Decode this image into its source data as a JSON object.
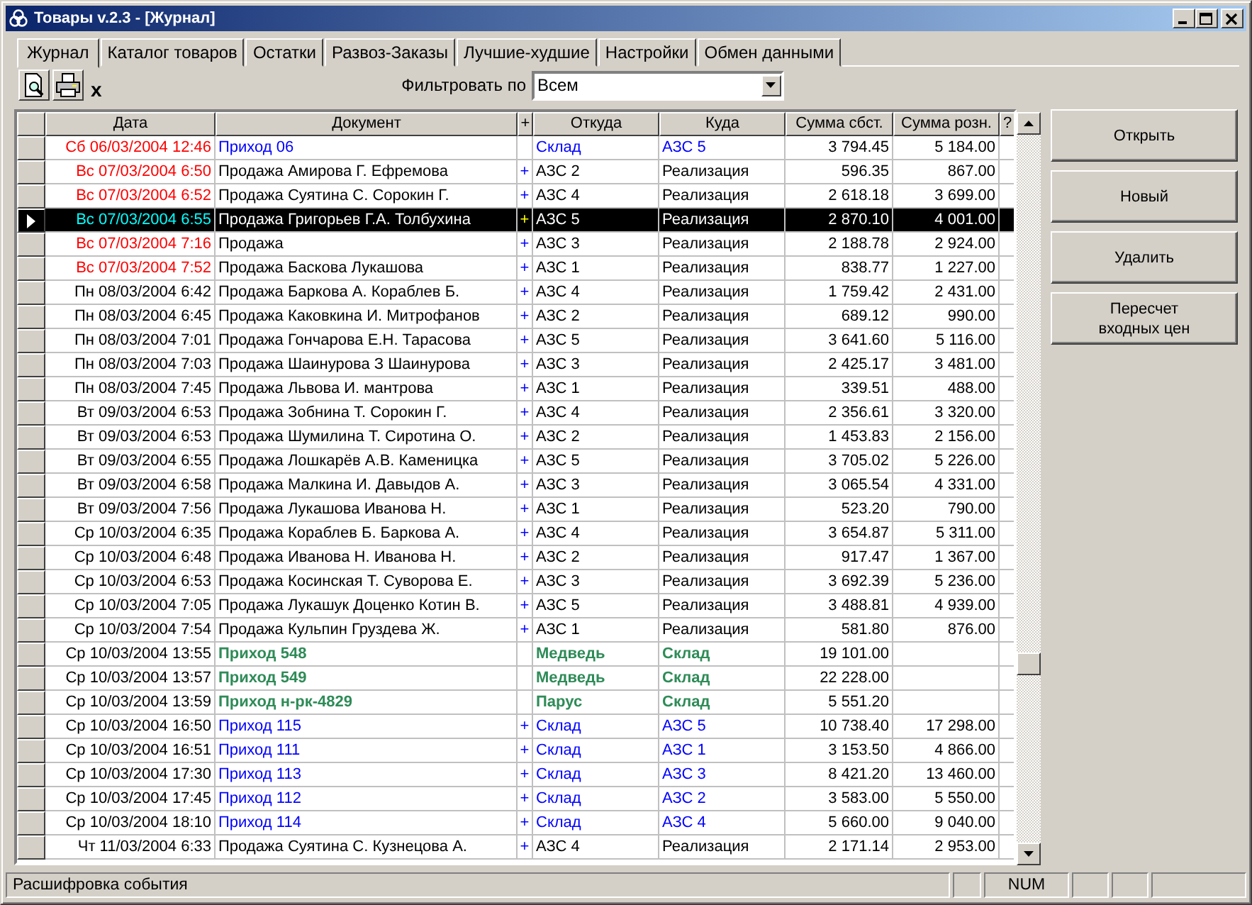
{
  "window": {
    "title": "Товары v.2.3 - [Журнал]"
  },
  "tabs": [
    {
      "label": "Журнал",
      "selected": true
    },
    {
      "label": "Каталог товаров",
      "selected": false
    },
    {
      "label": "Остатки",
      "selected": false
    },
    {
      "label": "Развоз-Заказы",
      "selected": false
    },
    {
      "label": "Лучшие-худшие",
      "selected": false
    },
    {
      "label": "Настройки",
      "selected": false
    },
    {
      "label": "Обмен данными",
      "selected": false
    }
  ],
  "toolbar": {
    "clear_label": "x"
  },
  "filter": {
    "label": "Фильтровать по",
    "value": "Всем"
  },
  "table": {
    "columns": [
      "Дата",
      "Документ",
      "+",
      "Откуда",
      "Куда",
      "Сумма сбст.",
      "Сумма розн.",
      "?"
    ],
    "rows": [
      {
        "date": "Сб 06/03/2004 12:46",
        "weekend": true,
        "document": "Приход 06",
        "from": "Склад",
        "to": "АЗС 5",
        "cost": "3 794.45",
        "retail": "5 184.00",
        "kind": "incoming",
        "selected": false
      },
      {
        "date": "Вс 07/03/2004 6:50",
        "weekend": true,
        "document": "Продажа Амирова Г. Ефремова",
        "plus": "+",
        "from": "АЗС 2",
        "to": "Реализация",
        "cost": "596.35",
        "retail": "867.00",
        "kind": "sale",
        "selected": false
      },
      {
        "date": "Вс 07/03/2004 6:52",
        "weekend": true,
        "document": "Продажа Суятина С. Сорокин Г.",
        "plus": "+",
        "from": "АЗС 4",
        "to": "Реализация",
        "cost": "2 618.18",
        "retail": "3 699.00",
        "kind": "sale",
        "selected": false
      },
      {
        "date": "Вс 07/03/2004 6:55",
        "weekend": true,
        "document": "Продажа Григорьев Г.А. Толбухина",
        "plus": "+",
        "from": "АЗС 5",
        "to": "Реализация",
        "cost": "2 870.10",
        "retail": "4 001.00",
        "kind": "sale",
        "selected": true
      },
      {
        "date": "Вс 07/03/2004 7:16",
        "weekend": true,
        "document": "Продажа",
        "plus": "+",
        "from": "АЗС 3",
        "to": "Реализация",
        "cost": "2 188.78",
        "retail": "2 924.00",
        "kind": "sale",
        "selected": false
      },
      {
        "date": "Вс 07/03/2004 7:52",
        "weekend": true,
        "document": "Продажа Баскова Лукашова",
        "plus": "+",
        "from": "АЗС 1",
        "to": "Реализация",
        "cost": "838.77",
        "retail": "1 227.00",
        "kind": "sale",
        "selected": false
      },
      {
        "date": "Пн 08/03/2004 6:42",
        "weekend": false,
        "document": "Продажа Баркова А. Кораблев Б.",
        "plus": "+",
        "from": "АЗС 4",
        "to": "Реализация",
        "cost": "1 759.42",
        "retail": "2 431.00",
        "kind": "sale",
        "selected": false
      },
      {
        "date": "Пн 08/03/2004 6:45",
        "weekend": false,
        "document": "Продажа Каковкина И. Митрофанов",
        "plus": "+",
        "from": "АЗС 2",
        "to": "Реализация",
        "cost": "689.12",
        "retail": "990.00",
        "kind": "sale",
        "selected": false
      },
      {
        "date": "Пн 08/03/2004 7:01",
        "weekend": false,
        "document": "Продажа Гончарова Е.Н. Тарасова",
        "plus": "+",
        "from": "АЗС 5",
        "to": "Реализация",
        "cost": "3 641.60",
        "retail": "5 116.00",
        "kind": "sale",
        "selected": false
      },
      {
        "date": "Пн 08/03/2004 7:03",
        "weekend": false,
        "document": "Продажа  Шаинурова З Шаинурова",
        "plus": "+",
        "from": "АЗС 3",
        "to": "Реализация",
        "cost": "2 425.17",
        "retail": "3 481.00",
        "kind": "sale",
        "selected": false
      },
      {
        "date": "Пн 08/03/2004 7:45",
        "weekend": false,
        "document": "Продажа Львова И. мантрова",
        "plus": "+",
        "from": "АЗС 1",
        "to": "Реализация",
        "cost": "339.51",
        "retail": "488.00",
        "kind": "sale",
        "selected": false
      },
      {
        "date": "Вт 09/03/2004 6:53",
        "weekend": false,
        "document": "Продажа Зобнина Т. Сорокин Г.",
        "plus": "+",
        "from": "АЗС 4",
        "to": "Реализация",
        "cost": "2 356.61",
        "retail": "3 320.00",
        "kind": "sale",
        "selected": false
      },
      {
        "date": "Вт 09/03/2004 6:53",
        "weekend": false,
        "document": "Продажа Шумилина Т. Сиротина О.",
        "plus": "+",
        "from": "АЗС 2",
        "to": "Реализация",
        "cost": "1 453.83",
        "retail": "2 156.00",
        "kind": "sale",
        "selected": false
      },
      {
        "date": "Вт 09/03/2004 6:55",
        "weekend": false,
        "document": "Продажа Лошкарёв А.В. Каменицка",
        "plus": "+",
        "from": "АЗС 5",
        "to": "Реализация",
        "cost": "3 705.02",
        "retail": "5 226.00",
        "kind": "sale",
        "selected": false
      },
      {
        "date": "Вт 09/03/2004 6:58",
        "weekend": false,
        "document": "Продажа Малкина И. Давыдов А.",
        "plus": "+",
        "from": "АЗС 3",
        "to": "Реализация",
        "cost": "3 065.54",
        "retail": "4 331.00",
        "kind": "sale",
        "selected": false
      },
      {
        "date": "Вт 09/03/2004 7:56",
        "weekend": false,
        "document": "Продажа Лукашова Иванова Н.",
        "plus": "+",
        "from": "АЗС 1",
        "to": "Реализация",
        "cost": "523.20",
        "retail": "790.00",
        "kind": "sale",
        "selected": false
      },
      {
        "date": "Ср 10/03/2004 6:35",
        "weekend": false,
        "document": "Продажа Кораблев Б. Баркова А.",
        "plus": "+",
        "from": "АЗС 4",
        "to": "Реализация",
        "cost": "3 654.87",
        "retail": "5 311.00",
        "kind": "sale",
        "selected": false
      },
      {
        "date": "Ср 10/03/2004 6:48",
        "weekend": false,
        "document": "Продажа Иванова Н. Иванова Н.",
        "plus": "+",
        "from": "АЗС 2",
        "to": "Реализация",
        "cost": "917.47",
        "retail": "1 367.00",
        "kind": "sale",
        "selected": false
      },
      {
        "date": "Ср 10/03/2004 6:53",
        "weekend": false,
        "document": "Продажа Косинская Т. Суворова Е.",
        "plus": "+",
        "from": "АЗС 3",
        "to": "Реализация",
        "cost": "3 692.39",
        "retail": "5 236.00",
        "kind": "sale",
        "selected": false
      },
      {
        "date": "Ср 10/03/2004 7:05",
        "weekend": false,
        "document": "Продажа Лукашук Доценко Котин В.",
        "plus": "+",
        "from": "АЗС 5",
        "to": "Реализация",
        "cost": "3 488.81",
        "retail": "4 939.00",
        "kind": "sale",
        "selected": false
      },
      {
        "date": "Ср 10/03/2004 7:54",
        "weekend": false,
        "document": "Продажа Кульпин Груздева Ж.",
        "plus": "+",
        "from": "АЗС 1",
        "to": "Реализация",
        "cost": "581.80",
        "retail": "876.00",
        "kind": "sale",
        "selected": false
      },
      {
        "date": "Ср 10/03/2004 13:55",
        "weekend": false,
        "document": "Приход 548",
        "from": "Медведь",
        "to": "Склад",
        "cost": "19 101.00",
        "kind": "supplier",
        "selected": false
      },
      {
        "date": "Ср 10/03/2004 13:57",
        "weekend": false,
        "document": "Приход 549",
        "from": "Медведь",
        "to": "Склад",
        "cost": "22 228.00",
        "kind": "supplier",
        "selected": false
      },
      {
        "date": "Ср 10/03/2004 13:59",
        "weekend": false,
        "document": "Приход н-рк-4829",
        "from": "Парус",
        "to": "Склад",
        "cost": "5 551.20",
        "kind": "supplier",
        "selected": false
      },
      {
        "date": "Ср 10/03/2004 16:50",
        "weekend": false,
        "document": "Приход 115",
        "plus": "+",
        "from": "Склад",
        "to": "АЗС 5",
        "cost": "10 738.40",
        "retail": "17 298.00",
        "kind": "incoming",
        "selected": false
      },
      {
        "date": "Ср 10/03/2004 16:51",
        "weekend": false,
        "document": "Приход 111",
        "plus": "+",
        "from": "Склад",
        "to": "АЗС 1",
        "cost": "3 153.50",
        "retail": "4 866.00",
        "kind": "incoming",
        "selected": false
      },
      {
        "date": "Ср 10/03/2004 17:30",
        "weekend": false,
        "document": "Приход 113",
        "plus": "+",
        "from": "Склад",
        "to": "АЗС 3",
        "cost": "8 421.20",
        "retail": "13 460.00",
        "kind": "incoming",
        "selected": false
      },
      {
        "date": "Ср 10/03/2004 17:45",
        "weekend": false,
        "document": "Приход 112",
        "plus": "+",
        "from": "Склад",
        "to": "АЗС 2",
        "cost": "3 583.00",
        "retail": "5 550.00",
        "kind": "incoming",
        "selected": false
      },
      {
        "date": "Ср 10/03/2004 18:10",
        "weekend": false,
        "document": "Приход 114",
        "plus": "+",
        "from": "Склад",
        "to": "АЗС 4",
        "cost": "5 660.00",
        "retail": "9 040.00",
        "kind": "incoming",
        "selected": false
      },
      {
        "date": "Чт 11/03/2004 6:33",
        "weekend": false,
        "document": "Продажа Суятина С. Кузнецова А.",
        "plus": "+",
        "from": "АЗС 4",
        "to": "Реализация",
        "cost": "2 171.14",
        "retail": "2 953.00",
        "kind": "sale",
        "selected": false
      }
    ]
  },
  "buttons": [
    "Открыть",
    "Новый",
    "Удалить",
    "Пересчет\nвходных цен"
  ],
  "status_bar": {
    "message": "Расшифровка события",
    "num": "NUM"
  }
}
